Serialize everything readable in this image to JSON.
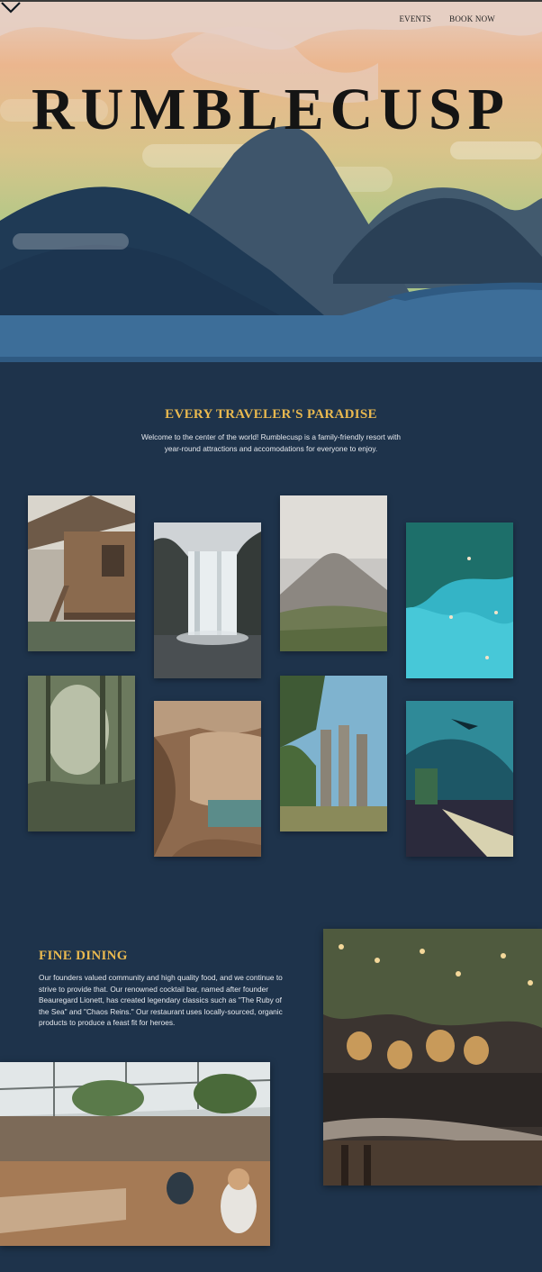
{
  "nav": {
    "events": "EVENTS",
    "book_now": "BOOK NOW"
  },
  "hero": {
    "brand": "RUMBLECUSP"
  },
  "intro": {
    "title": "EVERY TRAVELER'S PARADISE",
    "text": "Welcome to the center of the world! Rumblecusp is a family-friendly resort with year-round attractions and accomodations for everyone to enjoy."
  },
  "gallery": [
    "treehouse photo",
    "waterfall photo",
    "volcano photo",
    "lagoon swimmers photo",
    "rainforest photo",
    "cave photo",
    "ruins photo",
    "aquarium tunnel photo"
  ],
  "dining": {
    "title": "FINE DINING",
    "text": "Our founders valued community and high quality food, and we continue to strive to provide that. Our renowned cocktail bar, named after founder Beauregard Lionett, has created legendary classics such as \"The Ruby of the Sea\" and \"Chaos Reins.\" Our restaurant uses locally-sourced, organic products to produce a feast fit for heroes."
  },
  "colors": {
    "background": "#1e334b",
    "accent": "#e8b84f",
    "water": "#3d6e99"
  },
  "icons": {
    "scroll": "chevron-down-icon"
  }
}
